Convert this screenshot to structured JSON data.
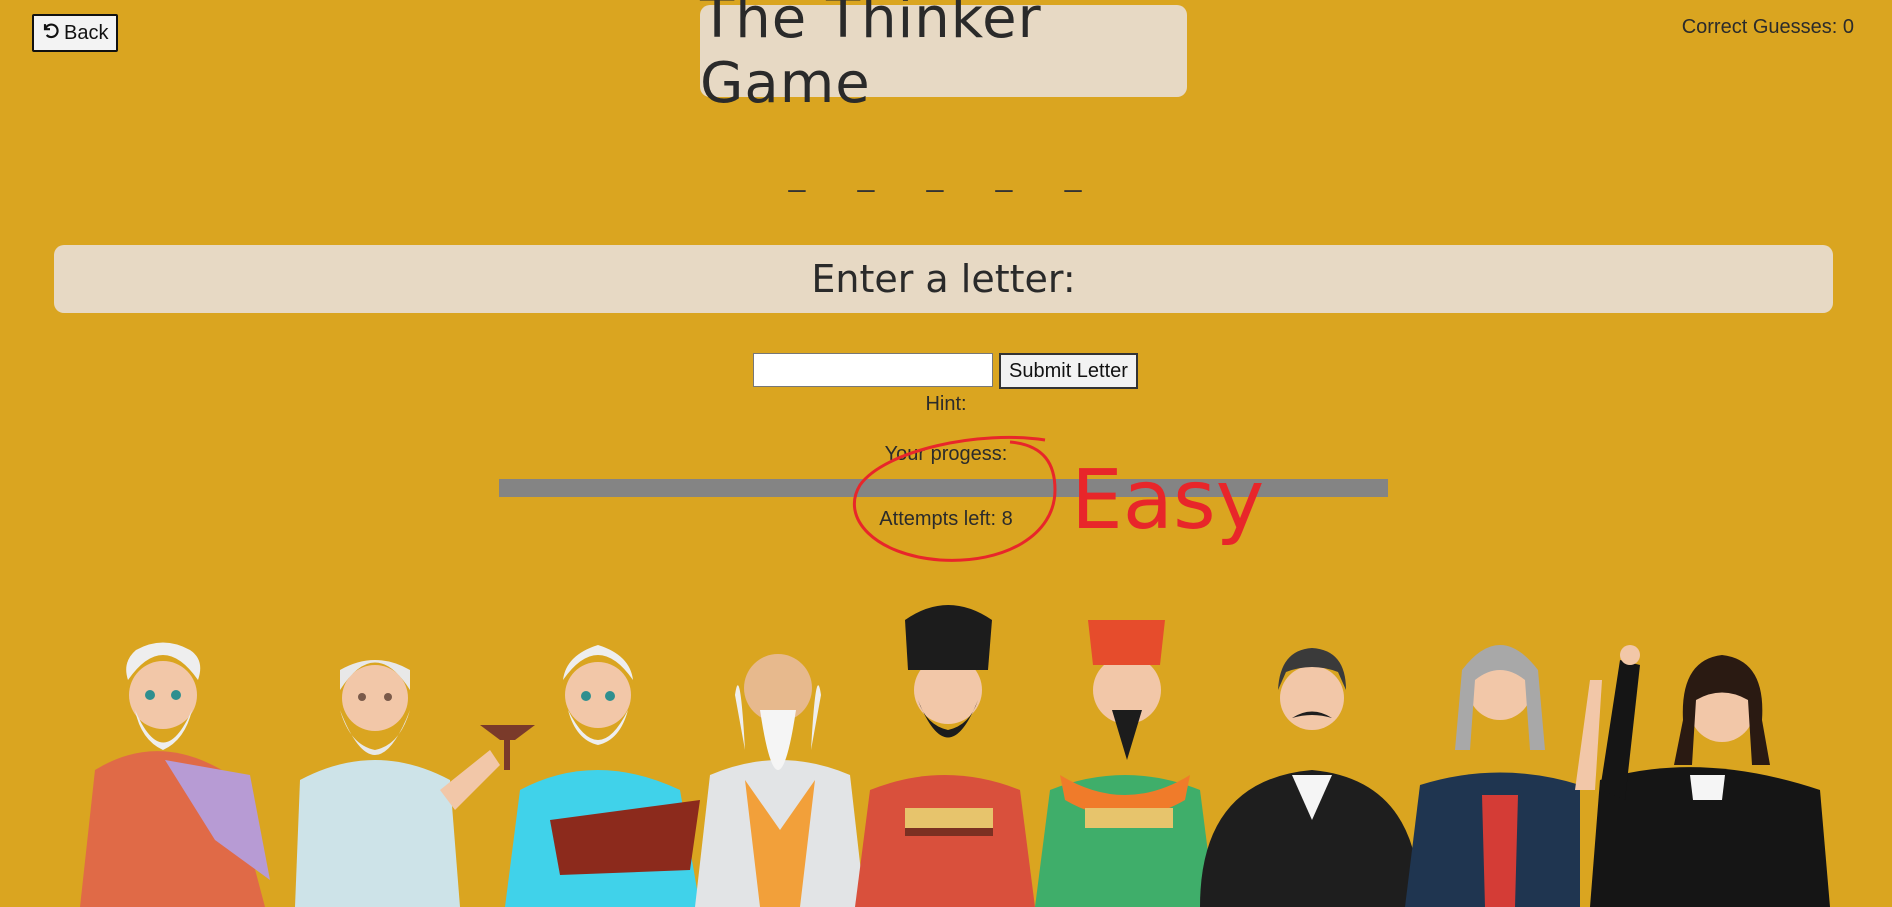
{
  "header": {
    "back_label": "Back",
    "title": "The Thinker Game",
    "correct_guesses": "Correct Guesses: 0"
  },
  "game": {
    "word_mask": "_ _ _ _ _",
    "prompt": "Enter a letter:",
    "input_value": "",
    "input_placeholder": "",
    "submit_label": "Submit Letter",
    "hint": "Hint:",
    "progress_label": "Your progess:",
    "progress_fraction": 0,
    "attempts": "Attempts left: 8"
  },
  "annotation": {
    "text": "Easy",
    "color": "#e8262a"
  },
  "colors": {
    "background": "#daa520",
    "panel": "#e7d9c4",
    "progress_track": "#848484"
  },
  "icons": [
    "undo-icon"
  ]
}
